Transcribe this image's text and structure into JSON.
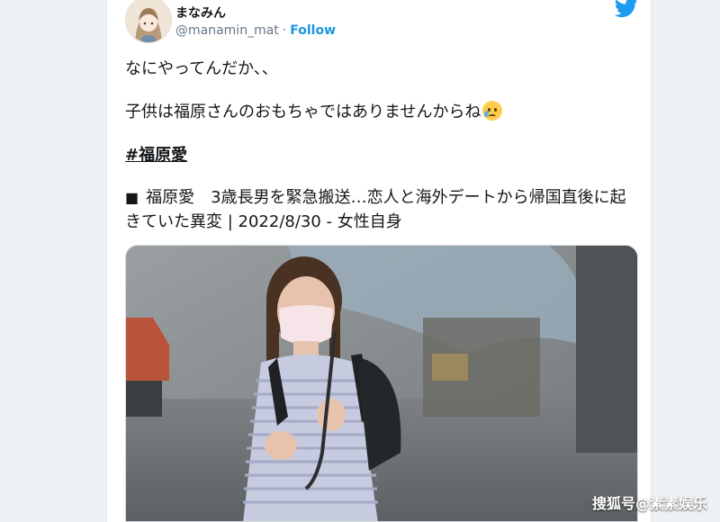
{
  "tweet": {
    "author": {
      "name": "まなみん",
      "handle": "@manamin_mat",
      "separator": "·",
      "follow_label": "Follow",
      "avatar_icon": "avatar-illustration"
    },
    "platform_icon": "twitter-bird-icon",
    "text_line1": "なにやってんだか、、",
    "text_line2": "子供は福原さんのおもちゃではありませんからね",
    "emoji": "sad-tear-face-emoji",
    "hashtag": "#福原愛",
    "link_card": {
      "bullet": "■",
      "title": "福原愛　3歳長男を緊急搬送…恋人と海外デートから帰国直後に起きていた異変 | 2022/8/30 - 女性自身"
    },
    "media": {
      "description_icon": "news-photo"
    }
  },
  "watermark": "搜狐号@素素娱乐",
  "colors": {
    "accent": "#1b95e0",
    "twitter_blue": "#1d9bf0",
    "text": "#14171a",
    "muted": "#657786"
  }
}
